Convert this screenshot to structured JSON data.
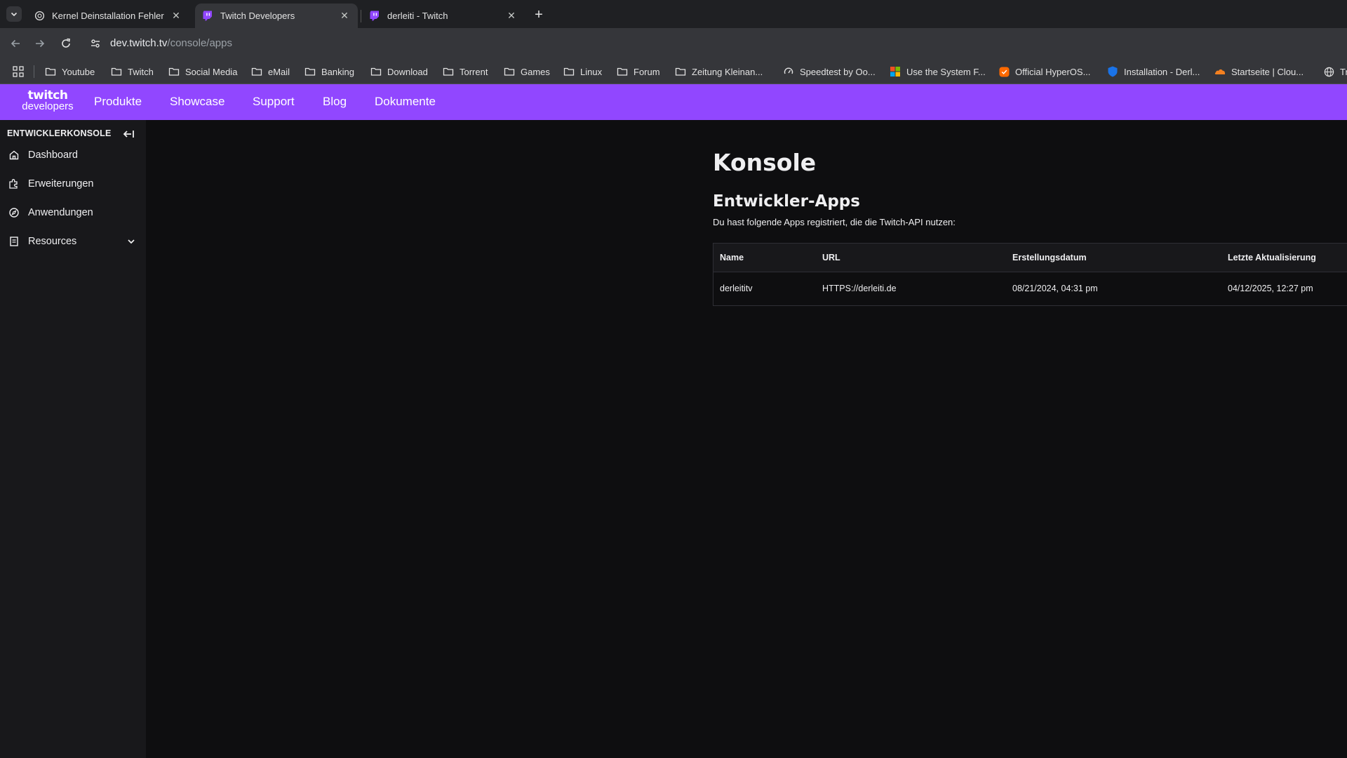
{
  "browser": {
    "tabs": [
      {
        "title": "Kernel Deinstallation Fehler",
        "icon": "chatgpt-icon",
        "active": false
      },
      {
        "title": "Twitch Developers",
        "icon": "twitch-icon",
        "active": true
      },
      {
        "title": "derleiti - Twitch",
        "icon": "twitch-icon",
        "active": false
      }
    ],
    "url_host": "dev.twitch.tv",
    "url_path": "/console/apps",
    "bookmarks": [
      {
        "label": "Youtube",
        "icon": "folder-icon"
      },
      {
        "label": "Twitch",
        "icon": "folder-icon"
      },
      {
        "label": "Social Media",
        "icon": "folder-icon"
      },
      {
        "label": "eMail",
        "icon": "folder-icon"
      },
      {
        "label": "Banking",
        "icon": "folder-icon"
      },
      {
        "label": "Download",
        "icon": "folder-icon"
      },
      {
        "label": "Torrent",
        "icon": "folder-icon"
      },
      {
        "label": "Games",
        "icon": "folder-icon"
      },
      {
        "label": "Linux",
        "icon": "folder-icon"
      },
      {
        "label": "Forum",
        "icon": "folder-icon"
      },
      {
        "label": "Zeitung Kleinan...",
        "icon": "folder-icon"
      },
      {
        "label": "Speedtest by Oo...",
        "icon": "speedtest-icon"
      },
      {
        "label": "Use the System F...",
        "icon": "microsoft-icon"
      },
      {
        "label": "Official HyperOS...",
        "icon": "hyperos-icon"
      },
      {
        "label": "Installation - Derl...",
        "icon": "shield-icon"
      },
      {
        "label": "Startseite | Clou...",
        "icon": "cloudflare-icon"
      },
      {
        "label": "Tr",
        "icon": "globe-icon"
      }
    ]
  },
  "header": {
    "logo_top": "twitch",
    "logo_bottom": "developers",
    "nav": [
      "Produkte",
      "Showcase",
      "Support",
      "Blog",
      "Dokumente"
    ]
  },
  "sidebar": {
    "title": "ENTWICKLERKONSOLE",
    "items": [
      {
        "label": "Dashboard",
        "icon": "home-icon"
      },
      {
        "label": "Erweiterungen",
        "icon": "extensions-icon"
      },
      {
        "label": "Anwendungen",
        "icon": "compass-icon"
      },
      {
        "label": "Resources",
        "icon": "document-icon"
      }
    ]
  },
  "main": {
    "title": "Konsole",
    "subtitle": "Entwickler-Apps",
    "description": "Du hast folgende Apps registriert, die die Twitch-API nutzen:",
    "table": {
      "columns": [
        "Name",
        "URL",
        "Erstellungsdatum",
        "Letzte Aktualisierung"
      ],
      "rows": [
        [
          "derleititv",
          "HTTPS://derleiti.de",
          "08/21/2024, 04:31 pm",
          "04/12/2025, 12:27 pm"
        ]
      ]
    }
  },
  "colors": {
    "twitch_purple": "#9147ff",
    "page_bg": "#0e0e10",
    "sidebar_bg": "#18181b"
  }
}
